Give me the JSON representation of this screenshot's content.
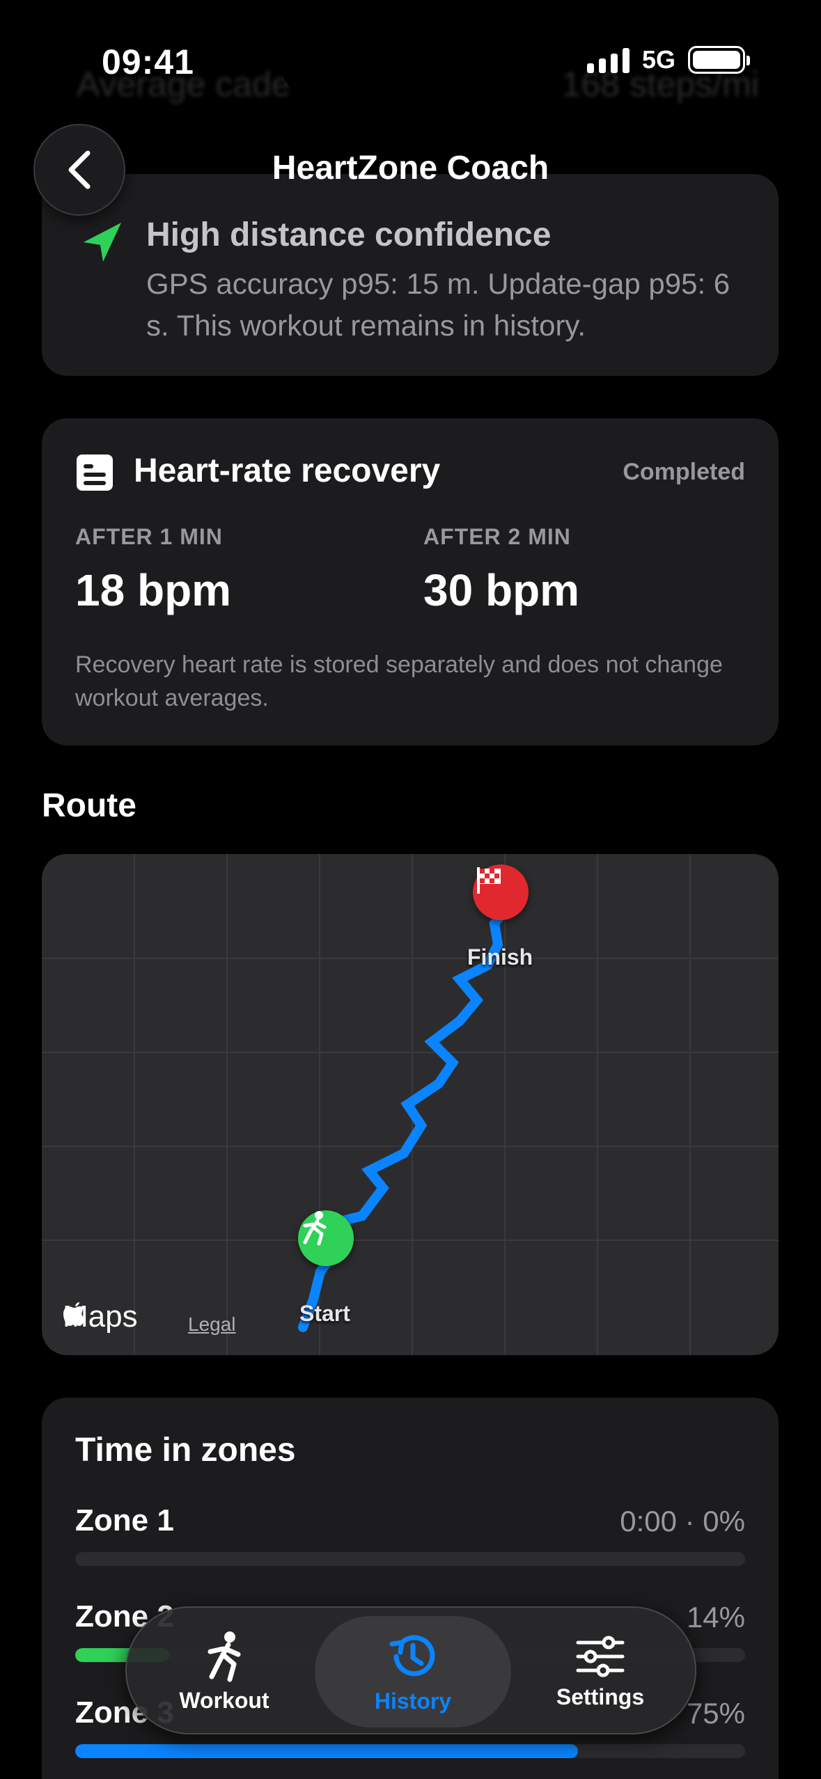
{
  "status_bar": {
    "time": "09:41",
    "network": "5G"
  },
  "background_row": {
    "label": "Average cade",
    "value": "168 steps/mi"
  },
  "nav": {
    "title": "HeartZone Coach"
  },
  "gps_card": {
    "icon": "location-arrow-icon",
    "title": "High distance confidence",
    "body": "GPS accuracy p95: 15 m. Update-gap p95: 6 s. This workout remains in history."
  },
  "recovery_card": {
    "icon": "report-card-icon",
    "title": "Heart-rate recovery",
    "status": "Completed",
    "after_1_label": "AFTER 1 MIN",
    "after_1_value": "18 bpm",
    "after_2_label": "AFTER 2 MIN",
    "after_2_value": "30 bpm",
    "note": "Recovery heart rate is stored separately and does not change workout averages."
  },
  "route": {
    "section_title": "Route",
    "start_label": "Start",
    "finish_label": "Finish",
    "maps_label": "Maps",
    "legal_label": "Legal",
    "route_color": "#0a84ff"
  },
  "zones": {
    "title": "Time in zones",
    "items": [
      {
        "name": "Zone 1",
        "value": "0:00 · 0%",
        "fraction": 0.0,
        "color": "#8e8e93"
      },
      {
        "name": "Zone 2",
        "value": "14%",
        "fraction": 0.14,
        "color": "#30d158"
      },
      {
        "name": "Zone 3",
        "value": "75%",
        "fraction": 0.75,
        "color": "#0a84ff"
      }
    ]
  },
  "tabbar": {
    "tabs": [
      {
        "label": "Workout",
        "icon": "running-figure-icon",
        "active": false
      },
      {
        "label": "History",
        "icon": "history-clock-icon",
        "active": true
      },
      {
        "label": "Settings",
        "icon": "sliders-icon",
        "active": false
      }
    ],
    "active_color": "#0a84ff"
  }
}
